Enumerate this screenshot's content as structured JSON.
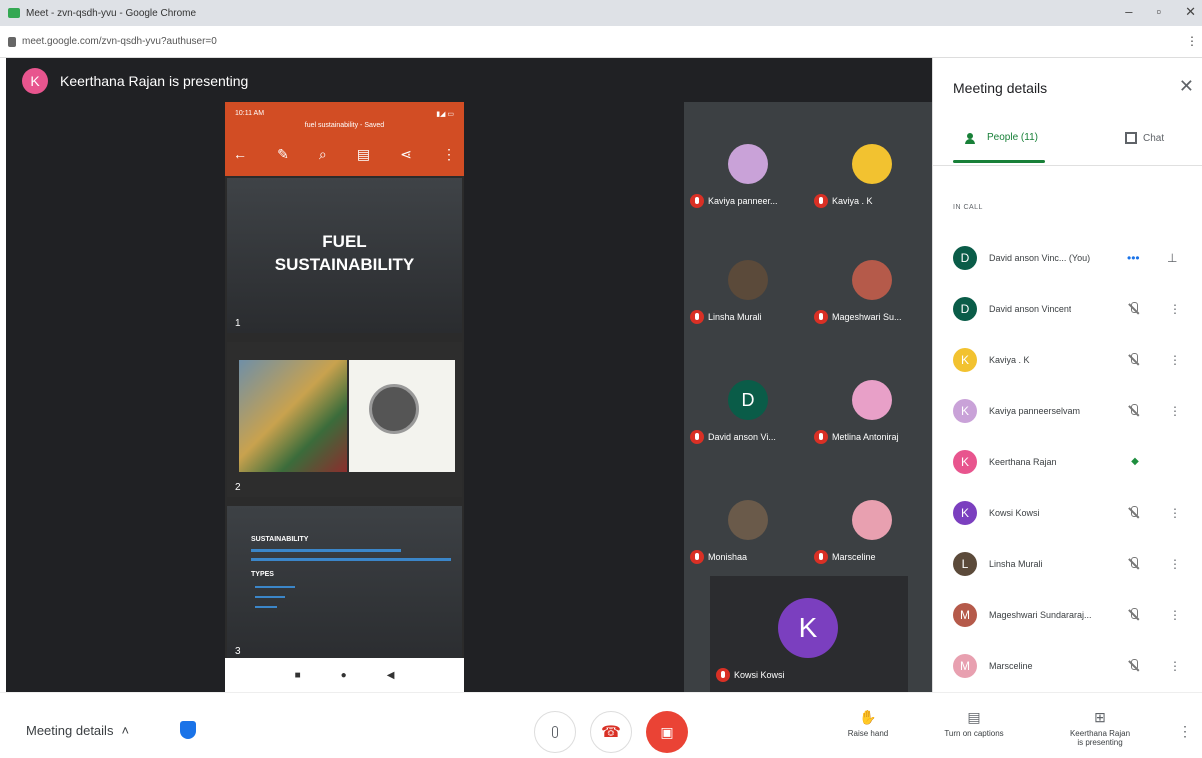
{
  "browser": {
    "tab_title": "Meet - zvn-qsdh-yvu - Google Chrome",
    "url": "meet.google.com/zvn-qsdh-yvu?authuser=0"
  },
  "presenter": {
    "initial": "K",
    "text": "Keerthana Rajan is presenting"
  },
  "phone": {
    "time": "10:11 AM",
    "doc_name": "fuel sustainability - Saved",
    "slides": [
      {
        "number": "1",
        "title_line1": "FUEL",
        "title_line2": "SUSTAINABILITY"
      },
      {
        "number": "2"
      },
      {
        "number": "3",
        "heading": "SUSTAINABILITY",
        "types": "TYPES"
      }
    ]
  },
  "tiles": [
    {
      "name": "Kaviya panneer...",
      "color": "#c9a2d8"
    },
    {
      "name": "Kaviya . K",
      "color": "#f2c230"
    },
    {
      "name": "Linsha Murali",
      "color": "#5b4a3a"
    },
    {
      "name": "Mageshwari Su...",
      "color": "#b55a4a"
    },
    {
      "name": "David anson Vi...",
      "initial": "D",
      "color": "#0a5c48"
    },
    {
      "name": "Metlina Antoniraj",
      "color": "#e8a0c8"
    },
    {
      "name": "Monishaa",
      "color": "#6a5a4a"
    },
    {
      "name": "Marsceline",
      "color": "#e8a0b0"
    }
  ],
  "big_tile": {
    "initial": "K",
    "name": "Kowsi Kowsi"
  },
  "panel": {
    "title": "Meeting details",
    "tab_people": "People (11)",
    "tab_chat": "Chat",
    "section": "IN CALL",
    "people": [
      {
        "name": "David anson Vinc...",
        "you": "(You)",
        "initial": "D",
        "color": "#0a5c48"
      },
      {
        "name": "David anson Vincent",
        "initial": "D",
        "color": "#0a5c48"
      },
      {
        "name": "Kaviya . K",
        "initial": "K",
        "color": "#f2c230"
      },
      {
        "name": "Kaviya panneerselvam",
        "initial": "K",
        "color": "#c9a2d8"
      },
      {
        "name": "Keerthana Rajan",
        "initial": "K",
        "color": "#e8558e"
      },
      {
        "name": "Kowsi Kowsi",
        "initial": "K",
        "color": "#7b3fbf"
      },
      {
        "name": "Linsha Murali",
        "initial": "L",
        "color": "#5b4a3a"
      },
      {
        "name": "Mageshwari Sundararaj...",
        "initial": "M",
        "color": "#b55a4a"
      },
      {
        "name": "Marsceline",
        "initial": "M",
        "color": "#e8a0b0"
      }
    ]
  },
  "bottom": {
    "meeting_details": "Meeting details",
    "raise_hand": "Raise hand",
    "captions": "Turn on captions",
    "present_line1": "Keerthana Rajan",
    "present_line2": "is presenting"
  }
}
